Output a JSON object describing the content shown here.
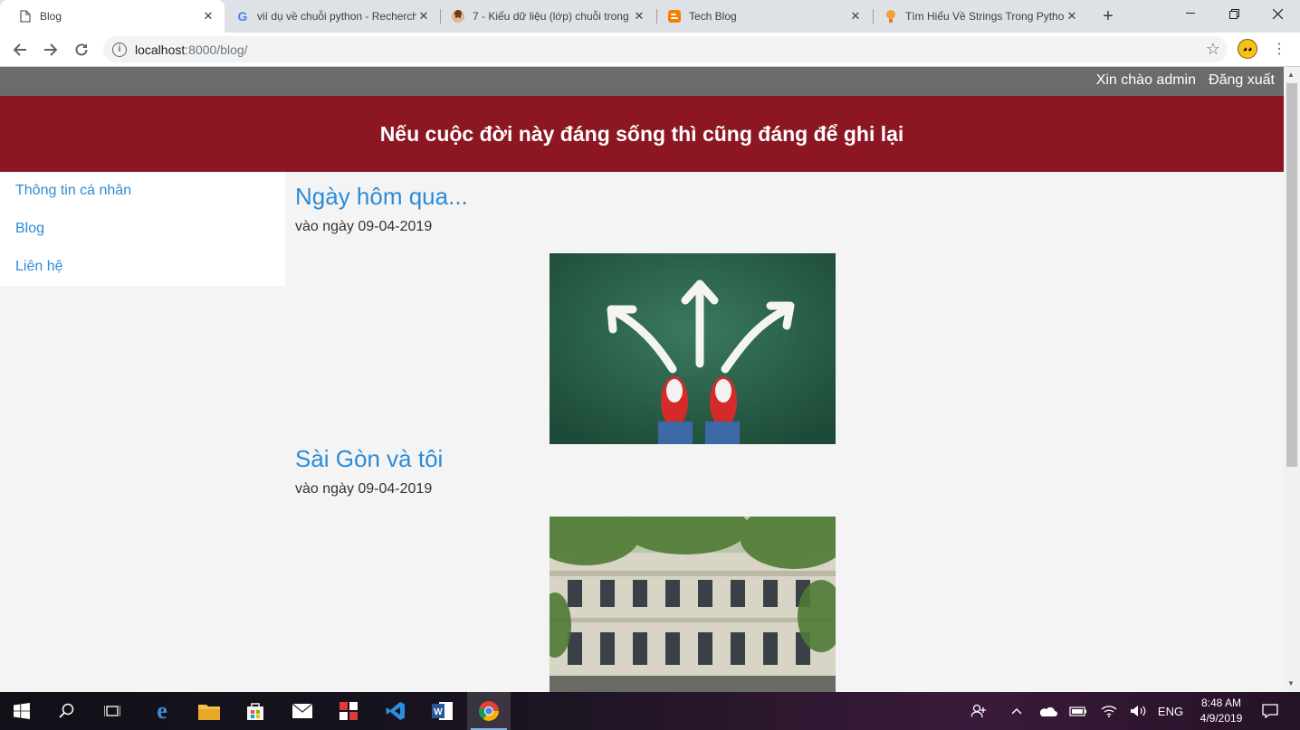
{
  "browser": {
    "tabs": [
      {
        "title": "Blog",
        "favicon": "page-icon"
      },
      {
        "title": "vií dụ về chuỗi python - Recherche",
        "favicon": "google-icon"
      },
      {
        "title": "7 - Kiểu dữ liệu (lớp) chuỗi trong",
        "favicon": "avatar-icon"
      },
      {
        "title": "Tech Blog",
        "favicon": "blogger-icon"
      },
      {
        "title": "Tìm Hiểu Về Strings Trong Python",
        "favicon": "tip-icon"
      }
    ],
    "address": {
      "host": "localhost",
      "path": ":8000/blog/"
    }
  },
  "page": {
    "userbar": {
      "greeting": "Xin chào admin",
      "logout": "Đăng xuất"
    },
    "banner": "Nếu cuộc đời này đáng sống thì cũng đáng để ghi lại",
    "sidebar": [
      {
        "label": "Thông tin cá nhân"
      },
      {
        "label": "Blog"
      },
      {
        "label": "Liên hệ"
      }
    ],
    "posts": [
      {
        "title": "Ngày hôm qua...",
        "date": "vào ngày 09-04-2019",
        "image": "arrows-chalkboard-red-sneakers"
      },
      {
        "title": "Sài Gòn và tôi",
        "date": "vào ngày 09-04-2019",
        "image": "colonial-building-with-trees"
      }
    ]
  },
  "taskbar": {
    "apps": [
      "windows-start",
      "search",
      "task-view",
      "edge",
      "file-explorer",
      "store",
      "mail",
      "app-grid",
      "vscode",
      "word",
      "chrome"
    ],
    "tray": {
      "language": "ENG",
      "time": "8:48 AM",
      "date": "4/9/2019"
    }
  },
  "colors": {
    "banner": "#8c1622",
    "userbar": "#6b6b6b",
    "link": "#2d8bd6"
  }
}
